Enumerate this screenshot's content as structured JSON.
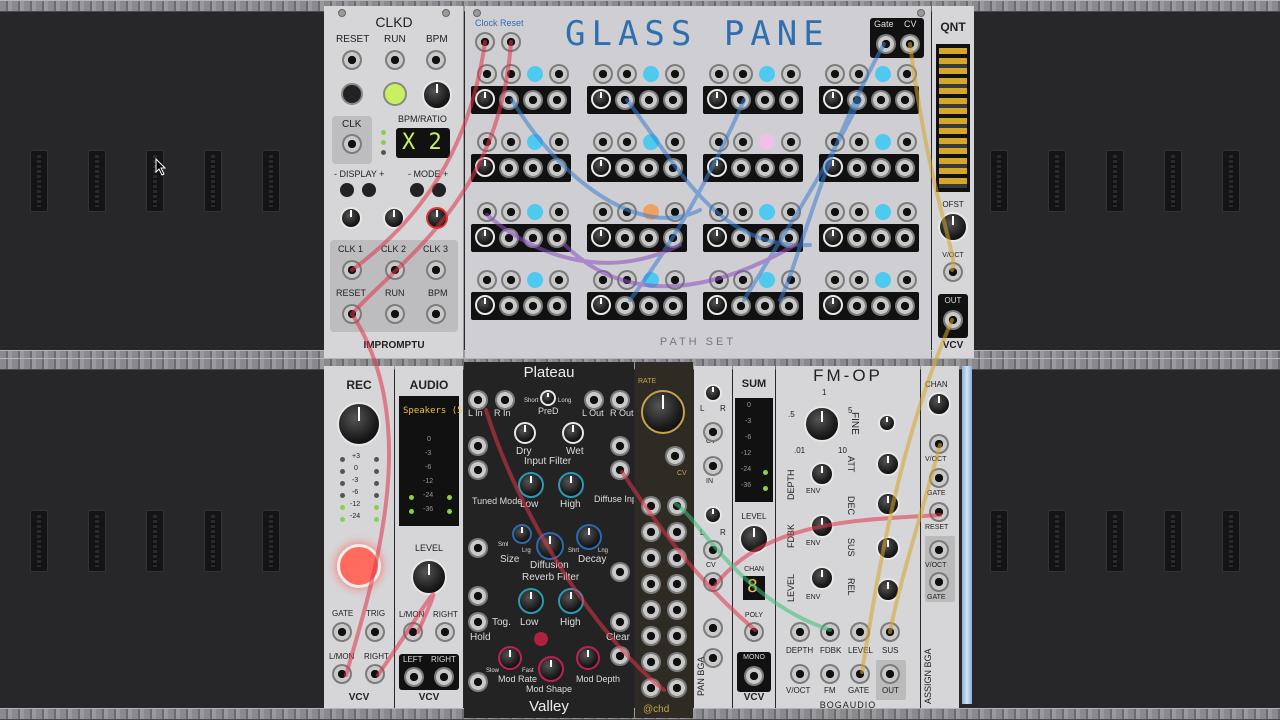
{
  "rack": {
    "modules": {
      "clkd": {
        "title": "CLKD",
        "top_labels": [
          "RESET",
          "RUN",
          "BPM"
        ],
        "clk_label": "CLK",
        "bpm_ratio_label": "BPM/RATIO",
        "display_value": "X 2",
        "display_label": "- DISPLAY +",
        "mode_label": "- MODE +",
        "clk_outs": [
          "CLK 1",
          "CLK 2",
          "CLK 3"
        ],
        "bottom_labels": [
          "RESET",
          "RUN",
          "BPM"
        ],
        "brand": "IMPROMPTU",
        "led_color": "#c8f060"
      },
      "glass_pane": {
        "title": "GLASS PANE",
        "input_labels": [
          "Clock",
          "Reset"
        ],
        "gate_cv_labels": [
          "Gate",
          "CV"
        ],
        "footer": "PATH SET"
      },
      "qnt": {
        "title": "QNT",
        "ofst_label": "OFST",
        "voct_label": "V/OCT",
        "out_label": "OUT",
        "brand": "VCV"
      },
      "rec": {
        "title": "REC",
        "meter_labels": [
          "+3",
          "0",
          "-3",
          "-6",
          "-12",
          "-24"
        ],
        "gate_label": "GATE",
        "trig_label": "TRIG",
        "lmon_label": "L/MON",
        "right_label": "RIGHT",
        "brand": "VCV",
        "rec_color": "#ff6b5f"
      },
      "audio": {
        "title": "AUDIO",
        "device": "Speakers (5",
        "meter_labels": [
          "0",
          "-3",
          "-6",
          "-12",
          "-24",
          "-36"
        ],
        "level_label": "LEVEL",
        "lmon_label": "L/MON",
        "right_label": "RIGHT",
        "left_label": "LEFT",
        "right2_label": "RIGHT",
        "brand": "VCV"
      },
      "plateau": {
        "title": "Plateau",
        "labels": [
          "L In",
          "R In",
          "PreD",
          "L Out",
          "R Out",
          "Dry",
          "Wet",
          "Input Filter",
          "Low",
          "High",
          "Diffuse Input",
          "Tuned Mode",
          "Size",
          "Diffusion",
          "Decay",
          "Reverb Filter",
          "Tog.",
          "Low",
          "High",
          "Hold",
          "Clear",
          "Mod Rate",
          "Mod Shape",
          "Mod Depth"
        ],
        "small_labels": [
          "Short",
          "Long",
          "Sml",
          "Lrg",
          "Shrt",
          "Lng",
          "Slow",
          "Fast"
        ],
        "brand": "Valley"
      },
      "echo": {
        "rate_label": "RATE",
        "cv_label": "CV",
        "brand": "@chd"
      },
      "pan": {
        "labels": [
          "L",
          "R",
          "CV",
          "IN",
          "L",
          "R",
          "CV"
        ],
        "brand": "PAN BGA"
      },
      "sum": {
        "title": "SUM",
        "meter_labels": [
          "0",
          "-3",
          "-6",
          "-12",
          "-24",
          "-36"
        ],
        "level_label": "LEVEL",
        "chan_label": "CHAN",
        "chan_value": "8",
        "poly_label": "POLY",
        "mono_label": "MONO",
        "brand": "VCV"
      },
      "fmop": {
        "title": "FM-OP",
        "ratio_labels": [
          "1",
          ".5",
          "5",
          ".01",
          "10"
        ],
        "fine_label": "FINE",
        "depth_label": "DEPTH",
        "fdbk_label": "FDBK",
        "level_label": "LEVEL",
        "env_label": "ENV",
        "att_label": "ATT",
        "dec_label": "DEC",
        "sus_label": "SUS",
        "rel_label": "REL",
        "jack_labels_top": [
          "DEPTH",
          "FDBK",
          "LEVEL",
          "SUS"
        ],
        "jack_labels_bottom": [
          "V/OCT",
          "FM",
          "GATE",
          "OUT"
        ],
        "brand": "BOGAUDIO"
      },
      "assign": {
        "chan_label": "CHAN",
        "voct_label": "V/OCT",
        "gate_label": "GATE",
        "reset_label": "RESET",
        "voct2_label": "V/OCT",
        "gate2_label": "GATE",
        "brand": "ASSIGN BGA"
      }
    }
  }
}
